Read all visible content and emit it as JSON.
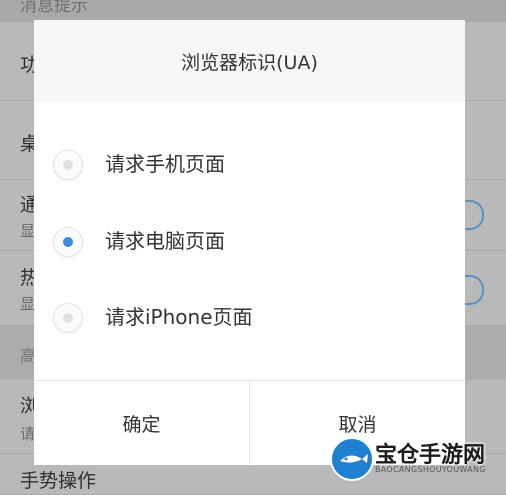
{
  "background": {
    "header": "消息提示",
    "rows": [
      {
        "title": "功",
        "sub": ""
      },
      {
        "title": "桌",
        "sub": ""
      },
      {
        "title": "通",
        "sub": "显"
      },
      {
        "title": "热",
        "sub": "显"
      },
      {
        "title": "浏",
        "sub": "请"
      },
      {
        "title": "手势操作",
        "sub": ""
      }
    ],
    "section": "高"
  },
  "dialog": {
    "title": "浏览器标识(UA)",
    "options": [
      {
        "label": "请求手机页面",
        "selected": false
      },
      {
        "label": "请求电脑页面",
        "selected": true
      },
      {
        "label": "请求iPhone页面",
        "selected": false
      }
    ],
    "confirm_label": "确定",
    "cancel_label": "取消"
  },
  "watermark": {
    "brand": "宝仓手游网",
    "subtitle": "BAOCANGSHOUYOUWANG"
  },
  "colors": {
    "accent": "#3d8be0",
    "dim_background": "#b9b9b9",
    "dialog_bg": "#ffffff"
  }
}
